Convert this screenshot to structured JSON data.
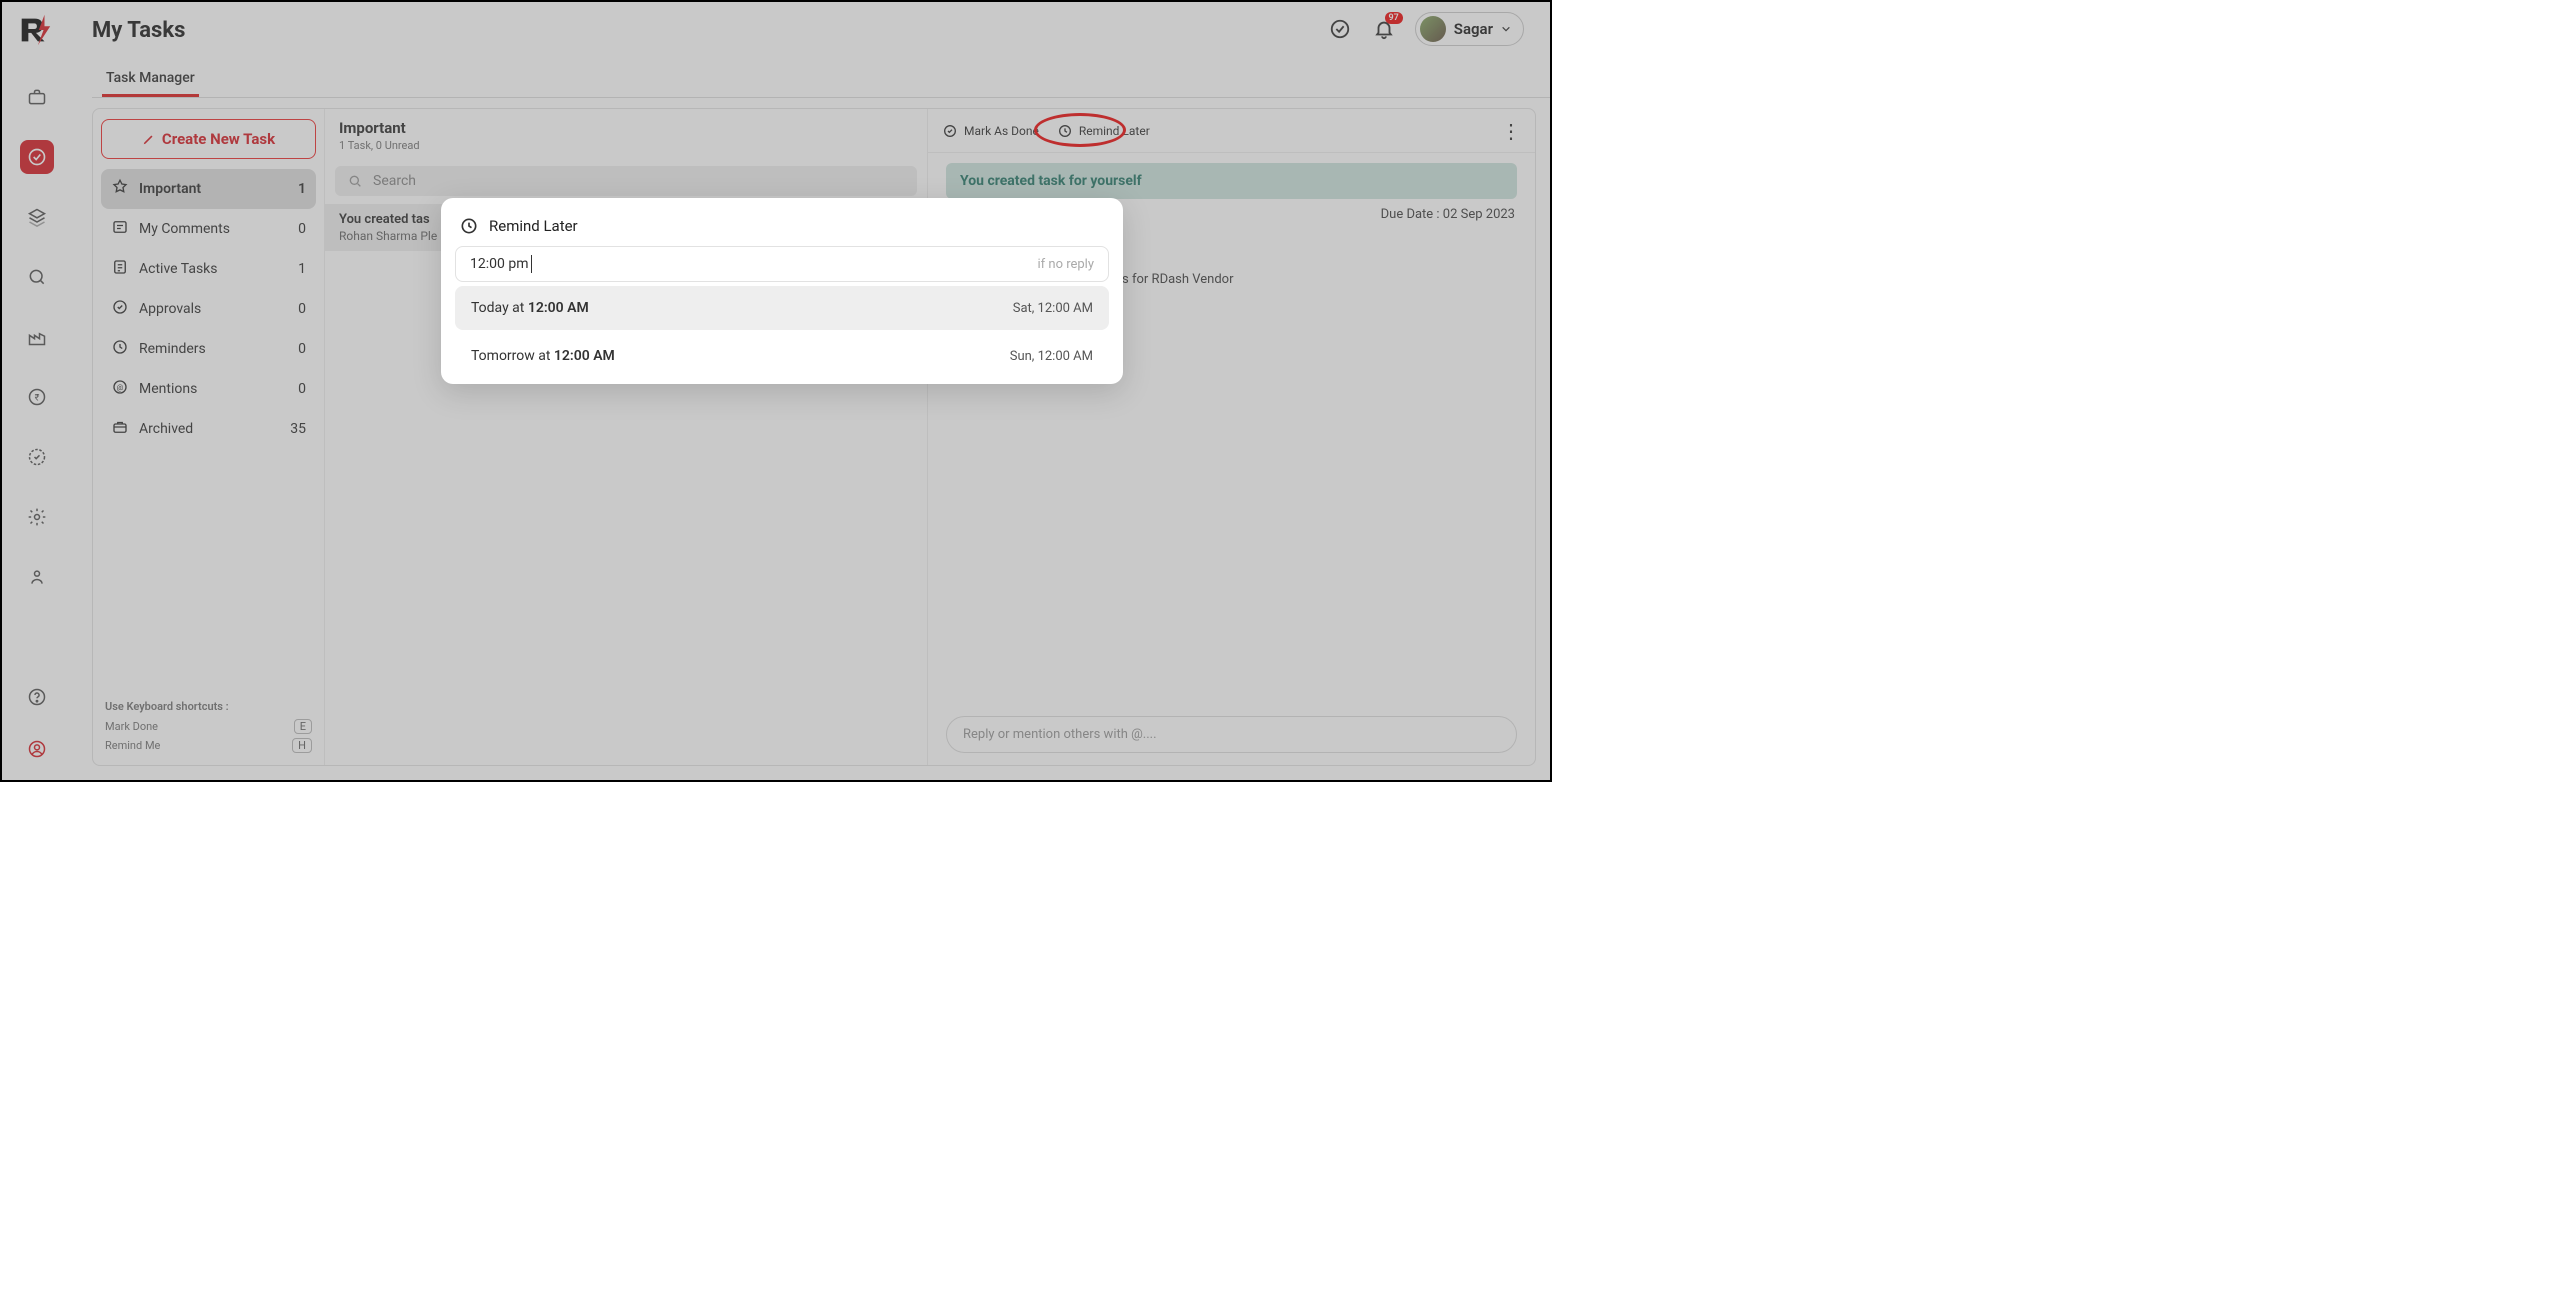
{
  "page_title": "My Tasks",
  "tab": "Task Manager",
  "user": {
    "name": "Sagar",
    "notif_badge": "97"
  },
  "sidebar": {
    "create_label": "Create New Task",
    "items": [
      {
        "label": "Important",
        "count": "1",
        "active": true
      },
      {
        "label": "My Comments",
        "count": "0"
      },
      {
        "label": "Active Tasks",
        "count": "1"
      },
      {
        "label": "Approvals",
        "count": "0"
      },
      {
        "label": "Reminders",
        "count": "0"
      },
      {
        "label": "Mentions",
        "count": "0"
      },
      {
        "label": "Archived",
        "count": "35"
      }
    ],
    "shortcuts_title": "Use Keyboard shortcuts :",
    "shortcuts": [
      {
        "label": "Mark Done",
        "key": "E"
      },
      {
        "label": "Remind Me",
        "key": "H"
      }
    ]
  },
  "list": {
    "title": "Important",
    "subtitle": "1 Task,  0 Unread",
    "search_placeholder": "Search",
    "item": {
      "line1": "You created tas",
      "line2": "Rohan Sharma Ple"
    }
  },
  "detail": {
    "mark_done": "Mark As Done",
    "remind_later": "Remind Later",
    "banner": "You created task for yourself",
    "due": "Due Date : 02 Sep 2023",
    "body_tail": "ues for RDash Vendor",
    "reply_placeholder": "Reply or mention others with @...."
  },
  "popover": {
    "title": "Remind Later",
    "input_value": "12:00 pm",
    "input_hint": "if no reply",
    "options": [
      {
        "prefix": "Today at ",
        "bold": "12:00 AM",
        "when": "Sat, 12:00 AM",
        "selected": true
      },
      {
        "prefix": "Tomorrow at ",
        "bold": "12:00 AM",
        "when": "Sun, 12:00 AM"
      }
    ]
  }
}
